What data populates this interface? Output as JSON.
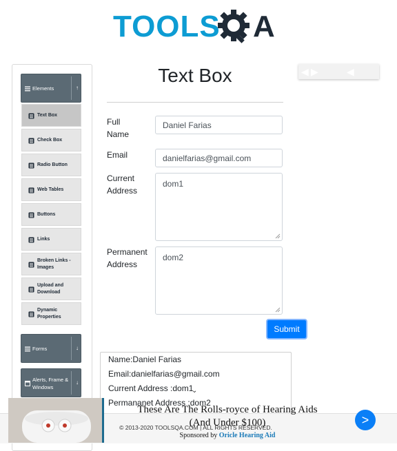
{
  "header": {
    "logo_text": "TOOLS",
    "logo_suffix": "A"
  },
  "sidebar": {
    "groups": [
      {
        "label": "Elements",
        "arrow": "↑"
      },
      {
        "label": "Forms",
        "arrow": "↓"
      },
      {
        "label": "Alerts, Frame & Windows",
        "arrow": "↓"
      }
    ],
    "items": [
      {
        "label": "Text Box"
      },
      {
        "label": "Check Box"
      },
      {
        "label": "Radio Button"
      },
      {
        "label": "Web Tables"
      },
      {
        "label": "Buttons"
      },
      {
        "label": "Links"
      },
      {
        "label": "Broken Links - Images"
      },
      {
        "label": "Upload and Download"
      },
      {
        "label": "Dynamic Properties"
      }
    ]
  },
  "form": {
    "title": "Text Box",
    "full_name_label": "Full Name",
    "full_name_value": "Daniel Farias",
    "email_label": "Email",
    "email_value": "danielfarias@gmail.com",
    "current_address_label": "Current Address",
    "current_address_value": "dom1",
    "permanent_address_label": "Permanent Address",
    "permanent_address_value": "dom2",
    "submit_label": "Submit"
  },
  "output": {
    "name": "Name:Daniel Farias",
    "email": "Email:danielfarias@gmail.com",
    "current_address": "Current Address :dom1",
    "permanent_address": "Permananet Address :dom2"
  },
  "footer": {
    "copyright": "© 2013-2020 TOOLSQA.COM | ALL RIGHTS RESERVED."
  },
  "ad": {
    "headline_line1": "These Are The Rolls-royce of Hearing Aids",
    "headline_line2": "(And Under $100)",
    "sponsored_prefix": "Sponsored by",
    "sponsor_name": "Oricle Hearing Aid",
    "next_label": ">"
  },
  "colors": {
    "brand_blue": "#0d9cd3",
    "sidebar_header": "#5b6a74",
    "primary_button": "#007bff"
  }
}
